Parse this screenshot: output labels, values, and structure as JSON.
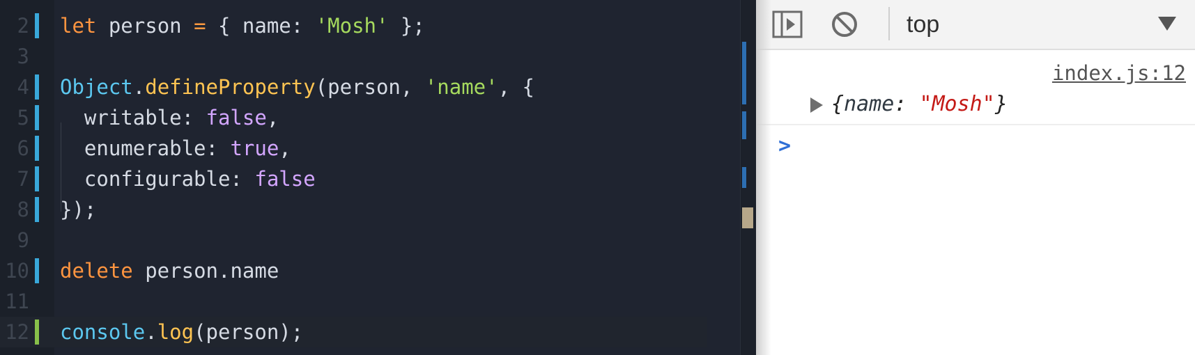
{
  "editor": {
    "lines": [
      {
        "num": "2",
        "marker": "mod",
        "tokens": [
          {
            "t": "let",
            "c": "kw"
          },
          {
            "t": " person ",
            "c": "id"
          },
          {
            "t": "=",
            "c": "op"
          },
          {
            "t": " { name: ",
            "c": "punc"
          },
          {
            "t": "'Mosh'",
            "c": "str"
          },
          {
            "t": " };",
            "c": "punc"
          }
        ]
      },
      {
        "num": "3",
        "marker": "",
        "tokens": []
      },
      {
        "num": "4",
        "marker": "mod",
        "tokens": [
          {
            "t": "Object",
            "c": "obj"
          },
          {
            "t": ".",
            "c": "punc"
          },
          {
            "t": "defineProperty",
            "c": "fn"
          },
          {
            "t": "(person, ",
            "c": "punc"
          },
          {
            "t": "'name'",
            "c": "str"
          },
          {
            "t": ", {",
            "c": "punc"
          }
        ]
      },
      {
        "num": "5",
        "marker": "mod",
        "tokens": [
          {
            "t": "  writable: ",
            "c": "prop"
          },
          {
            "t": "false",
            "c": "bool"
          },
          {
            "t": ",",
            "c": "punc"
          }
        ]
      },
      {
        "num": "6",
        "marker": "mod",
        "tokens": [
          {
            "t": "  enumerable: ",
            "c": "prop"
          },
          {
            "t": "true",
            "c": "bool"
          },
          {
            "t": ",",
            "c": "punc"
          }
        ]
      },
      {
        "num": "7",
        "marker": "mod",
        "tokens": [
          {
            "t": "  configurable: ",
            "c": "prop"
          },
          {
            "t": "false",
            "c": "bool"
          }
        ]
      },
      {
        "num": "8",
        "marker": "mod",
        "tokens": [
          {
            "t": "});",
            "c": "punc"
          }
        ]
      },
      {
        "num": "9",
        "marker": "",
        "tokens": []
      },
      {
        "num": "10",
        "marker": "mod",
        "tokens": [
          {
            "t": "delete",
            "c": "kw"
          },
          {
            "t": " person.name",
            "c": "id"
          }
        ]
      },
      {
        "num": "11",
        "marker": "",
        "tokens": []
      },
      {
        "num": "12",
        "marker": "add",
        "current": true,
        "tokens": [
          {
            "t": "console",
            "c": "obj"
          },
          {
            "t": ".",
            "c": "punc"
          },
          {
            "t": "log",
            "c": "fn"
          },
          {
            "t": "(person);",
            "c": "punc"
          }
        ]
      }
    ]
  },
  "console": {
    "toolbar": {
      "sidebar_icon": "sidebar-toggle-icon",
      "clear_icon": "clear-console-icon",
      "context": "top",
      "context_arrow_icon": "dropdown-arrow-icon"
    },
    "log": {
      "source": "index.js:12",
      "preview_open": "{",
      "key": "name",
      "colon": ": ",
      "value": "\"Mosh\"",
      "preview_close": "}"
    },
    "prompt": ">"
  },
  "colors": {
    "editor_bg": "#1f2430",
    "git_modified": "#39a8da",
    "git_added": "#88c04a",
    "string": "#a6da5e",
    "keyword": "#ff9540",
    "function": "#ffc452",
    "boolean": "#d3a6ff",
    "object": "#5cc8f0",
    "console_value": "#c41a16",
    "prompt": "#2f6fd6"
  }
}
